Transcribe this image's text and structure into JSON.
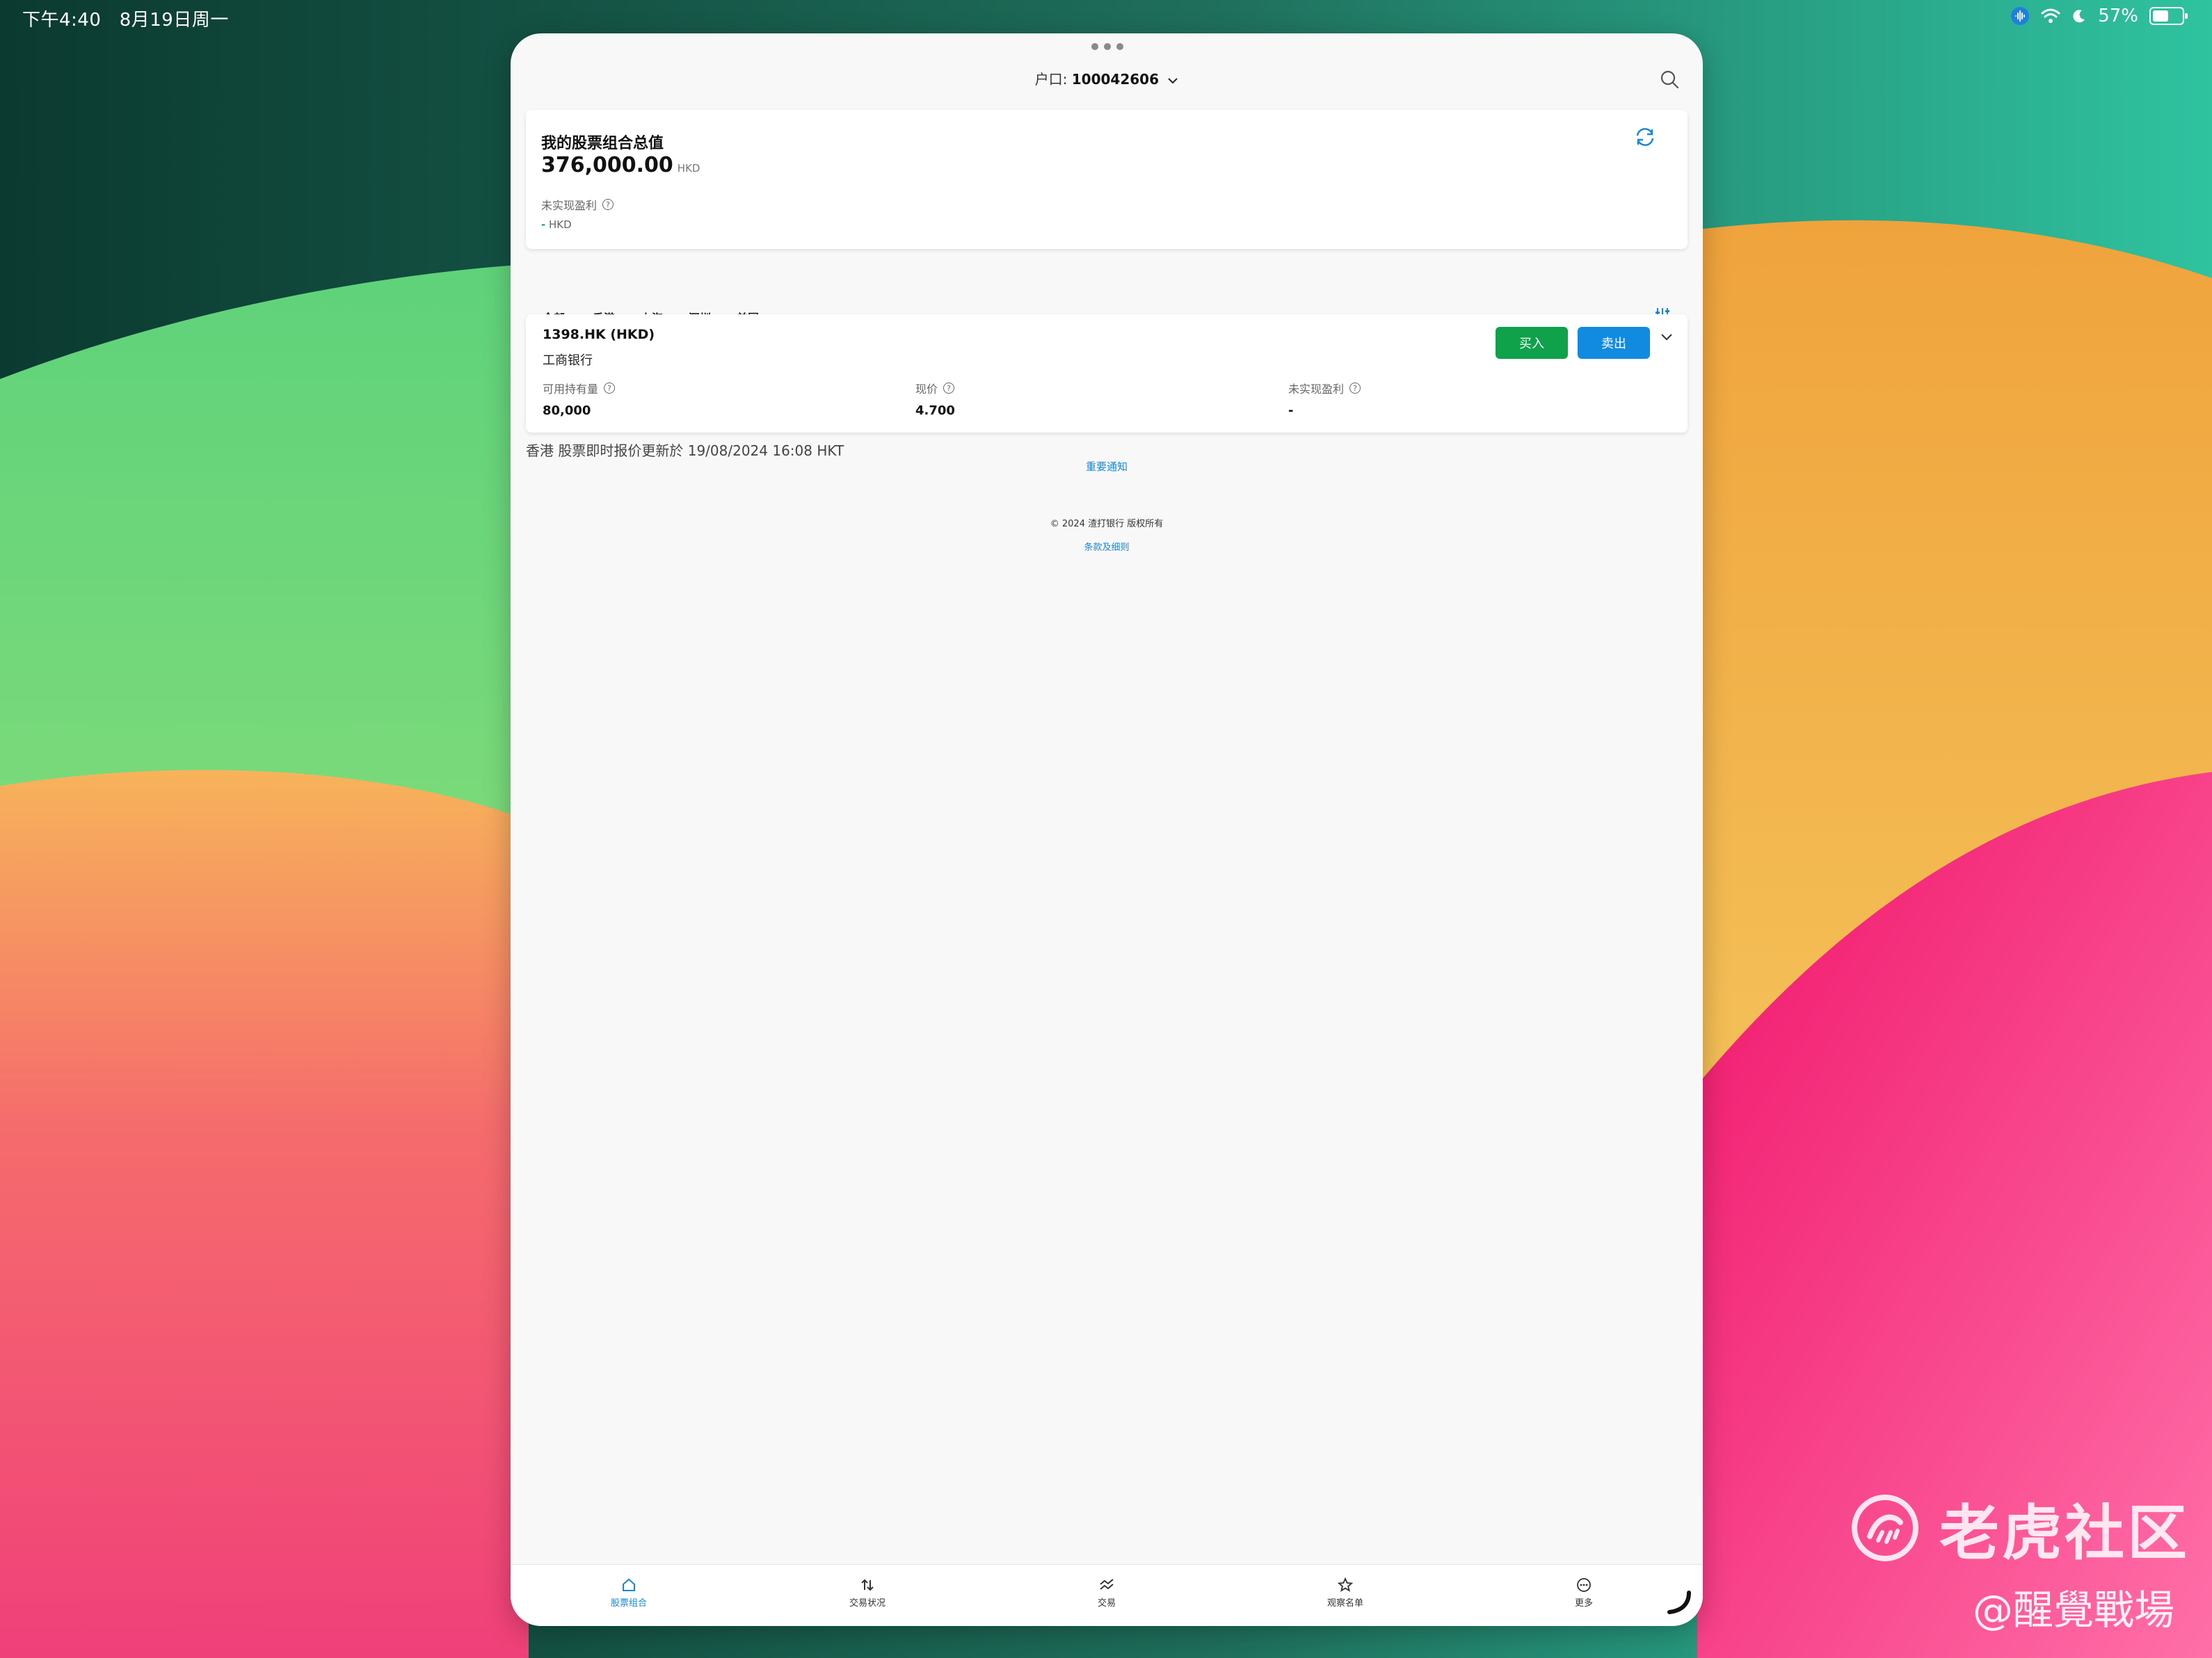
{
  "status_bar": {
    "time": "下午4:40",
    "date": "8月19日周一",
    "battery": "57%",
    "battery_level": 0.57
  },
  "header": {
    "account_label": "户口:",
    "account_number": "100042606"
  },
  "summary": {
    "title": "我的股票组合总值",
    "total_value": "376,000.00",
    "currency": "HKD",
    "unrealized_label": "未实现盈利",
    "unrealized_value": "-",
    "unrealized_currency": "HKD"
  },
  "tabs": [
    {
      "label": "全部"
    },
    {
      "label": "香港"
    },
    {
      "label": "上海"
    },
    {
      "label": "深圳"
    },
    {
      "label": "美国"
    }
  ],
  "holding": {
    "symbol": "1398.HK (HKD)",
    "name": "工商银行",
    "buy_label": "买入",
    "sell_label": "卖出",
    "quantity_label": "可用持有量",
    "quantity": "80,000",
    "price_label": "现价",
    "price": "4.700",
    "unrealized_label": "未实现盈利",
    "unrealized": "-"
  },
  "footer": {
    "quote_notice": "香港 股票即时报价更新於 19/08/2024 16:08 HKT",
    "important_notice": "重要通知",
    "copyright": "© 2024 渣打银行 版权所有",
    "terms": "条款及细则"
  },
  "nav": [
    {
      "label": "股票组合",
      "icon": "home-icon"
    },
    {
      "label": "交易状况",
      "icon": "transfer-arrows-icon"
    },
    {
      "label": "交易",
      "icon": "trend-icon"
    },
    {
      "label": "观察名单",
      "icon": "star-icon"
    },
    {
      "label": "更多",
      "icon": "more-icon"
    }
  ],
  "watermark": {
    "brand": "老虎社区",
    "handle": "@醒覺戰場"
  },
  "colors": {
    "accent_blue": "#1a86d4",
    "buy_green": "#0fa24a",
    "sell_blue": "#118be0"
  }
}
